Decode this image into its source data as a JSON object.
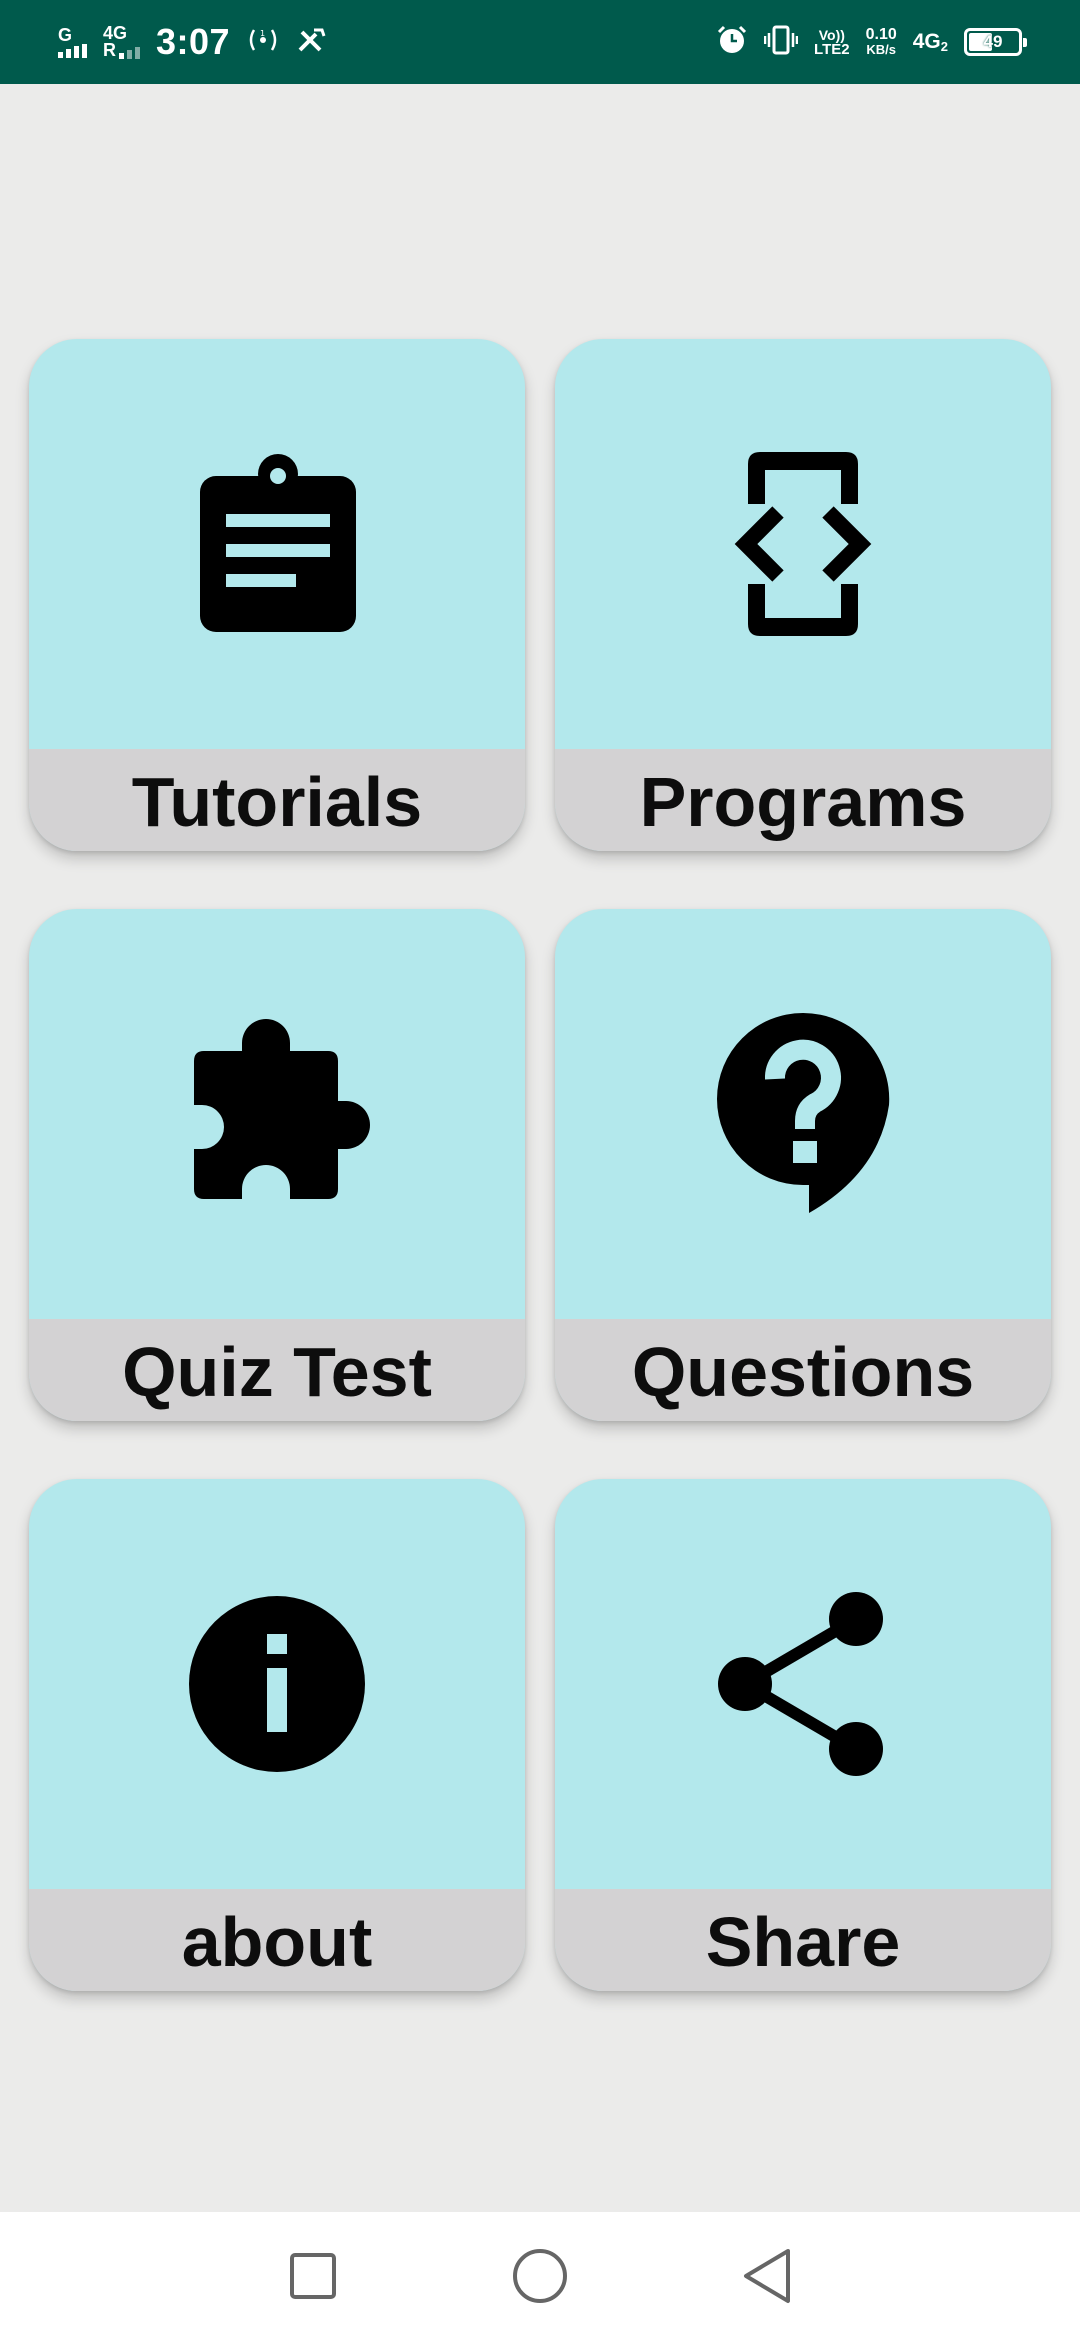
{
  "status_bar": {
    "network_1": "G",
    "network_2": "4G",
    "network_2_sub": "R",
    "time": "3:07",
    "volte_top": "Vo))",
    "volte_bottom": "LTE2",
    "speed_value": "0.10",
    "speed_unit": "KB/s",
    "network_right": "4G",
    "network_right_sub": "2",
    "battery": "49",
    "battery_level_percent": 49
  },
  "menu": {
    "tutorials": "Tutorials",
    "programs": "Programs",
    "quiz": "Quiz Test",
    "questions": "Questions",
    "about": "about",
    "share": "Share"
  },
  "colors": {
    "status_bar": "#005a4c",
    "card_top": "#b3e8ec",
    "card_bottom": "#d3d2d3",
    "background": "#ebebea"
  },
  "icons": {
    "tutorials": "assignment-icon",
    "programs": "developer-mode-icon",
    "quiz": "puzzle-icon",
    "questions": "help-bubble-icon",
    "about": "info-icon",
    "share": "share-icon"
  }
}
